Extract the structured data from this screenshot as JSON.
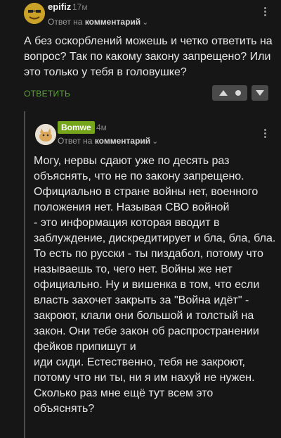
{
  "comment1": {
    "username": "epifiz",
    "time": "17м",
    "reply_prefix": "Ответ на",
    "reply_target": "комментарий",
    "text": "А без оскорблений можешь и четко ответить на вопрос? Так по какому закону запрещено? Или это только у тебя в головушке?",
    "reply_button": "ОТВЕТИТЬ"
  },
  "comment2": {
    "username": "Bomwe",
    "time": "4м",
    "reply_prefix": "Ответ на",
    "reply_target": "комментарий",
    "text": "Могу, нервы сдают уже по десять раз объяснять, что не по закону запрещено. Официально в стране войны нет, военного положения нет. Называя СВО войной\n- это информация которая вводит в заблуждение, дискредитирует и бла, бла, бла. То есть по русски - ты пиздабол, потому что называешь то, чего нет. Войны же нет официально. Ну и вишенка в том, что если власть захочет закрыть за \"Война идёт\" - закроют, клали они большой и толстый на закон. Они тебе закон об распространении фейков припишут и\nиди сиди. Естественно, тебя не закроют, потому что ни ты, ни я им нахуй не нужен. Сколько раз мне ещё тут всем это объяснять?"
  },
  "colors": {
    "background": "#161616",
    "accent_green": "#5ea23a",
    "badge_green": "#74a51b"
  },
  "icons": [
    "avatar-meme-face",
    "avatar-cat",
    "more-vertical-icon",
    "vote-up-icon",
    "vote-down-icon",
    "chevron-down-icon"
  ]
}
